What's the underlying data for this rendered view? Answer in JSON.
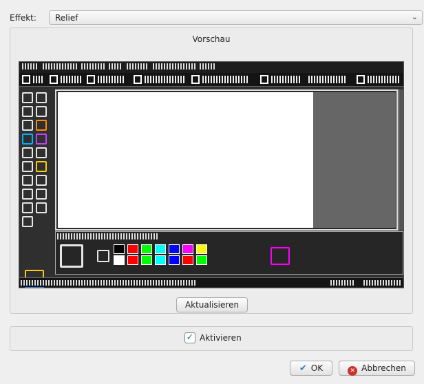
{
  "effect": {
    "label": "Effekt:",
    "value": "Relief"
  },
  "preview": {
    "title": "Vorschau"
  },
  "update_button": "Aktualisieren",
  "activate": {
    "label": "Aktivieren",
    "checked": true
  },
  "buttons": {
    "ok": "OK",
    "cancel": "Abbrechen"
  },
  "icons": {
    "dropdown": "chevron-down-icon",
    "checkbox": "checkmark-icon",
    "ok": "check-icon",
    "cancel": "cancel-icon"
  },
  "colors": {
    "ok_icon": "#3a78b8",
    "cancel_icon": "#c9332c"
  },
  "palette_colors": [
    "#000000",
    "#ffffff",
    "#ff0000",
    "#ff0000",
    "#00ff00",
    "#00ff00",
    "#00ffff",
    "#00ffff",
    "#0000ff",
    "#0000ff",
    "#ff00ff",
    "#ff0000",
    "#ffff00",
    "#00ff00"
  ]
}
